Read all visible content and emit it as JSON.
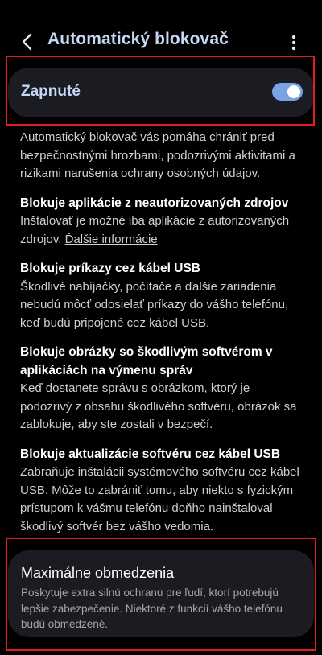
{
  "header": {
    "title": "Automatický blokovač",
    "back_icon": "chevron-left-icon",
    "more_icon": "more-vertical-icon"
  },
  "toggle": {
    "label": "Zapnuté",
    "state": "on"
  },
  "intro": "Automatický blokovač vás pomáha chrániť pred bezpečnostnými hrozbami, podozrivými aktivitami a rizikami narušenia ochrany osobných údajov.",
  "sections": [
    {
      "title": "Blokuje aplikácie z neautorizovaných zdrojov",
      "desc": "Inštalovať je možné iba aplikácie z autorizovaných zdrojov.",
      "link": "Ďalšie informácie"
    },
    {
      "title": "Blokuje príkazy cez kábel USB",
      "desc": "Škodlivé nabíjačky, počítače a ďalšie zariadenia nebudú môcť odosielať príkazy do vášho telefónu, keď budú pripojené cez kábel USB."
    },
    {
      "title": "Blokuje obrázky so škodlivým softvérom v aplikáciách na výmenu správ",
      "desc": "Keď dostanete správu s obrázkom, ktorý je podozrivý z obsahu škodlivého softvéru, obrázok sa zablokuje, aby ste zostali v bezpečí."
    },
    {
      "title": "Blokuje aktualizácie softvéru cez kábel USB",
      "desc": "Zabraňuje inštalácii systémového softvéru cez kábel USB. Môže to zabrániť tomu, aby niekto s fyzickým prístupom k vášmu telefónu doňho nainštaloval škodlivý softvér bez vášho vedomia."
    }
  ],
  "max_card": {
    "title": "Maximálne obmedzenia",
    "desc": "Poskytuje extra silnú ochranu pre ľudí, ktorí potrebujú lepšie zabezpečenie. Niektoré z funkcií vášho telefónu budú obmedzené."
  },
  "colors": {
    "background": "#000000",
    "card": "#1a1c21",
    "title_blue": "#c5d7f5",
    "switch_on": "#7aa3e6",
    "highlight_red": "#e02020"
  }
}
